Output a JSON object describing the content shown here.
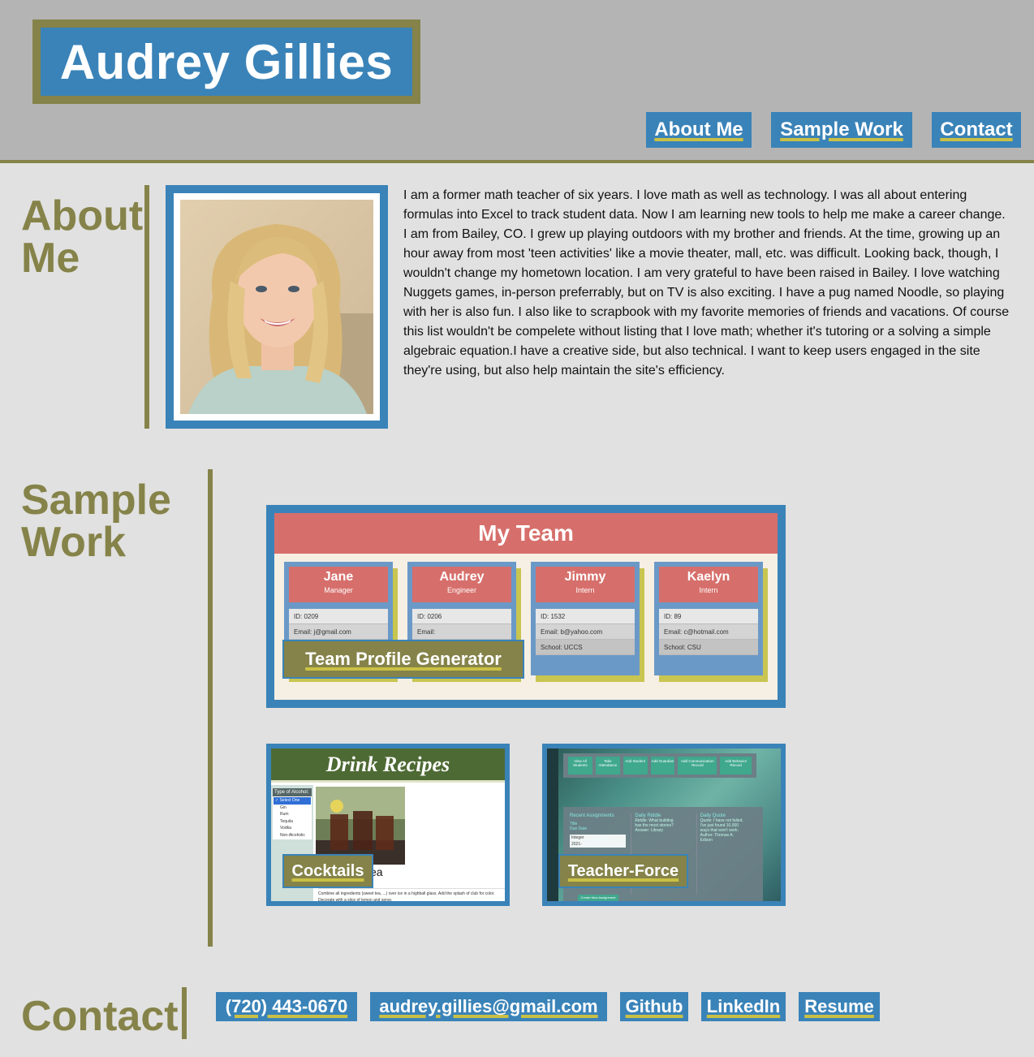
{
  "header": {
    "name": "Audrey Gillies",
    "nav": [
      "About Me",
      "Sample Work",
      "Contact"
    ]
  },
  "about": {
    "title": "About Me",
    "text": "I am a former math teacher of six years. I love math as well as technology. I was all about entering formulas into Excel to track student data. Now I am learning new tools to help me make a career change. I am from Bailey, CO. I grew up playing outdoors with my brother and friends. At the time, growing up an hour away from most 'teen activities' like a movie theater, mall, etc. was difficult. Looking back, though, I wouldn't change my hometown location. I am very grateful to have been raised in Bailey. I love watching Nuggets games, in-person preferrably, but on TV is also exciting. I have a pug named Noodle, so playing with her is also fun. I also like to scrapbook with my favorite memories of friends and vacations. Of course this list wouldn't be compelete without listing that I love math; whether it's tutoring or a solving a simple algebraic equation.I have a creative side, but also technical. I want to keep users engaged in the site they're using, but also help maintain the site's efficiency."
  },
  "work": {
    "title": "Sample Work",
    "projects": [
      {
        "label": "Team Profile Generator",
        "screenshot": {
          "heading": "My Team",
          "members": [
            {
              "name": "Jane",
              "role": "Manager",
              "rows": [
                "ID: 0209",
                "Email: j@gmail.com",
                ""
              ]
            },
            {
              "name": "Audrey",
              "role": "Engineer",
              "rows": [
                "ID: 0206",
                "Email:",
                ""
              ]
            },
            {
              "name": "Jimmy",
              "role": "Intern",
              "rows": [
                "ID: 1532",
                "Email: b@yahoo.com",
                "School: UCCS"
              ]
            },
            {
              "name": "Kaelyn",
              "role": "Intern",
              "rows": [
                "ID: 89",
                "Email: c@hotmail.com",
                "School: CSU"
              ]
            }
          ]
        }
      },
      {
        "label": "Cocktails",
        "screenshot": {
          "heading": "Drink Recipes",
          "select_label": "Type of Alcohol:",
          "options": [
            "✓ Select One",
            "Gin",
            "Rum",
            "Tequila",
            "Vodka",
            "Non-Alcoholic"
          ],
          "recipe_suffix": "ea",
          "body_text": "Combine all ingredients (sweet tea, ...) over ice in a highball glass. Add the splash of club for color. Decorate with a slice of lemon and serve."
        }
      },
      {
        "label": "Teacher-Force",
        "screenshot": {
          "buttons": [
            "View All Students",
            "Take Attendance",
            "Add Student",
            "Add Guardian",
            "Add Communication Record",
            "Add Behavior Record"
          ],
          "panels": [
            {
              "title": "Recent Assignments",
              "lines": [
                "Title",
                "Due Date",
                "Integer",
                "2021-"
              ]
            },
            {
              "title": "Daily Riddle",
              "lines": [
                "Riddle: What building",
                "has the most stories?",
                "Answer: Library"
              ]
            },
            {
              "title": "Daily Quote",
              "lines": [
                "Quote: I have not failed.",
                "I've just found 10,000",
                "ways that won't work.",
                "Author: Thomas A.",
                "Edison"
              ]
            }
          ],
          "footer_button": "Create New Assignment"
        }
      }
    ]
  },
  "contact": {
    "title": "Contact",
    "phone": "(720) 443-0670",
    "email": "audrey.gillies@gmail.com",
    "github": "Github",
    "linkedin": "LinkedIn",
    "resume": "Resume"
  },
  "colors": {
    "header_bg": "#b4b4b4",
    "page_bg": "#e1e1e1",
    "olive": "#858349",
    "blue": "#3a83b8",
    "underline": "#c9c045"
  }
}
